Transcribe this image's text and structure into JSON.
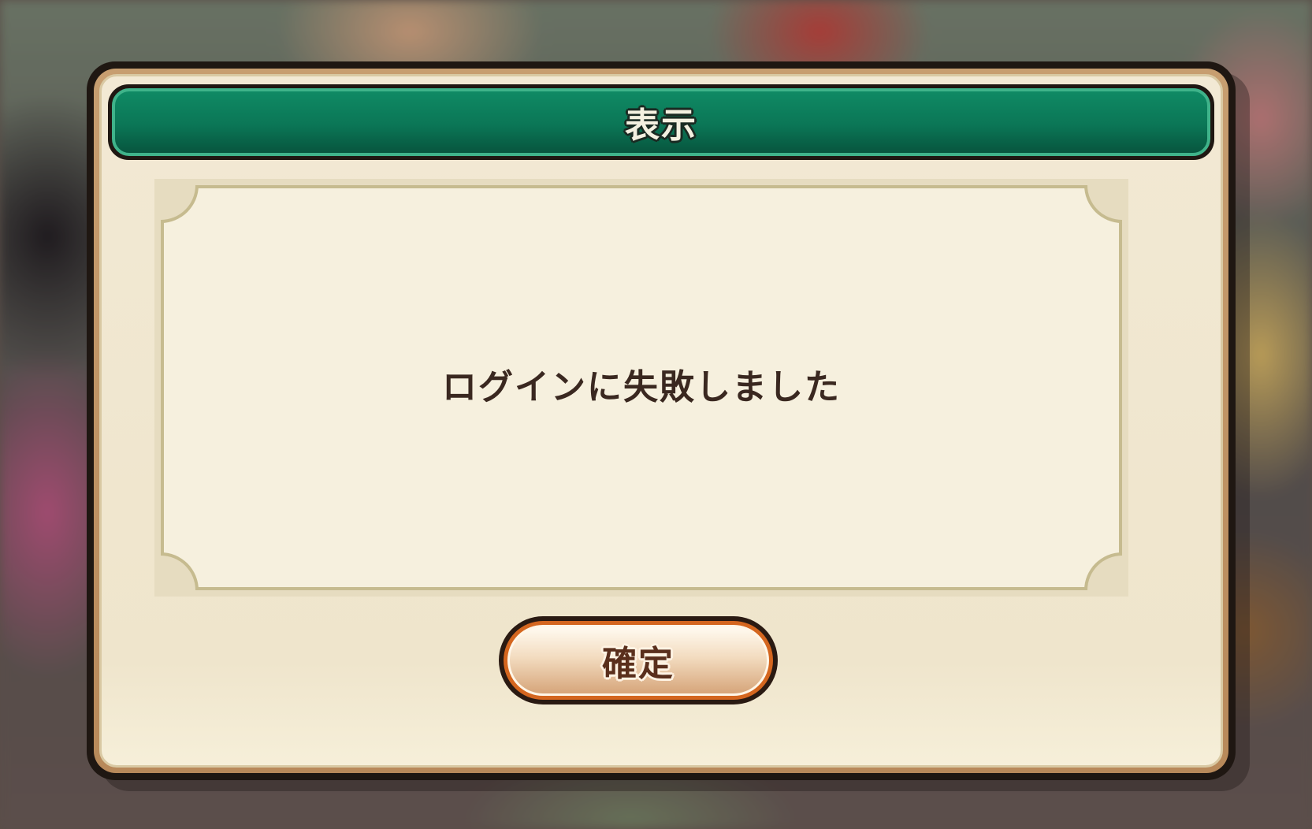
{
  "dialog": {
    "title": "表示",
    "message": "ログインに失敗しました",
    "confirm_label": "確定"
  },
  "colors": {
    "title_bar": "#0b7656",
    "title_bar_border": "#3fb38a",
    "panel_background": "#f6f0de",
    "message_text": "#3a2820",
    "button_ring": "#d4661f",
    "button_text": "#5a2f1c"
  }
}
